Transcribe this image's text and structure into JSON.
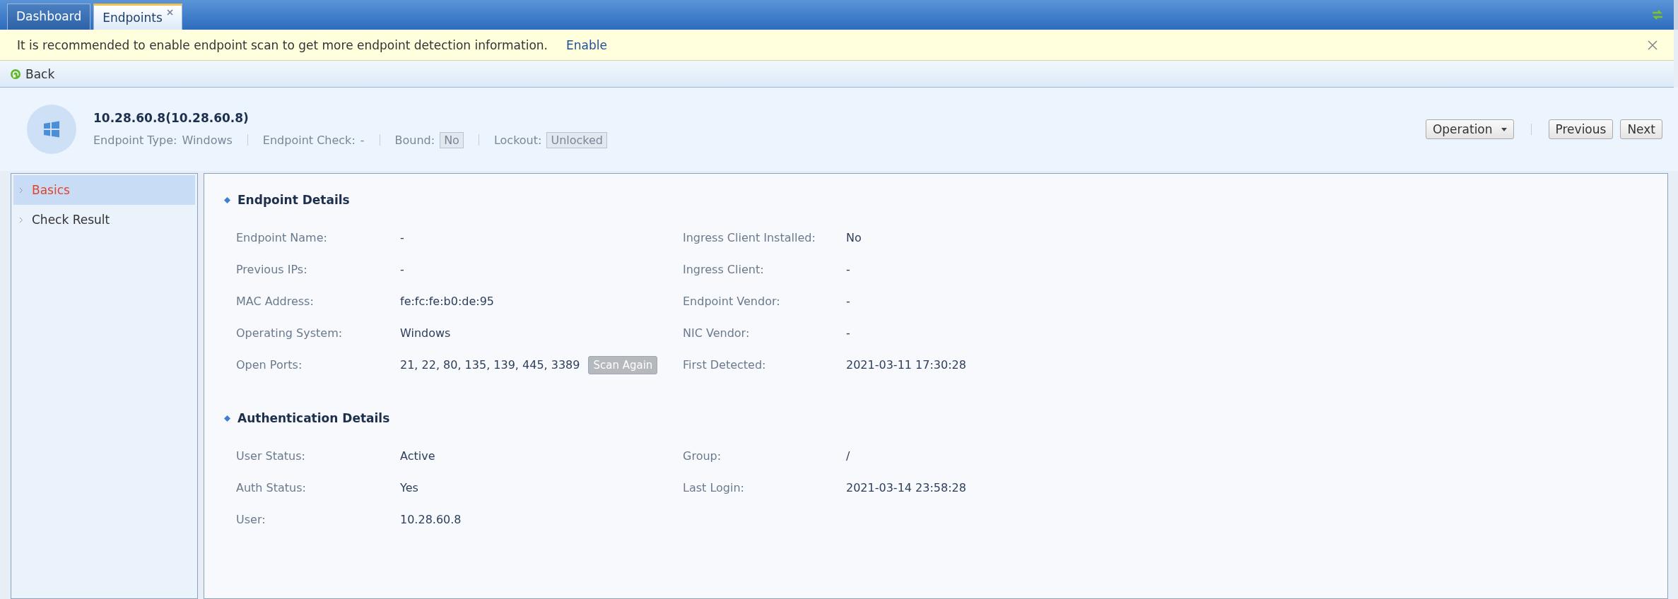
{
  "tabs": [
    {
      "label": "Dashboard",
      "selected": false,
      "closable": false
    },
    {
      "label": "Endpoints",
      "selected": true,
      "closable": true
    }
  ],
  "notice": {
    "text": "It is recommended to enable endpoint scan to get more endpoint detection information.",
    "link": "Enable"
  },
  "toolbar": {
    "back": "Back"
  },
  "endpoint": {
    "title": "10.28.60.8(10.28.60.8)",
    "meta": [
      {
        "label": "Endpoint Type:",
        "value": "Windows",
        "kind": "plain"
      },
      {
        "label": "Endpoint Check:",
        "value": "-",
        "kind": "plain"
      },
      {
        "label": "Bound:",
        "value": "No",
        "kind": "tag"
      },
      {
        "label": "Lockout:",
        "value": "Unlocked",
        "kind": "tag"
      }
    ],
    "actions": [
      {
        "label": "Operation",
        "kind": "dropdown"
      },
      {
        "label": "Previous",
        "kind": "button"
      },
      {
        "label": "Next",
        "kind": "button"
      }
    ]
  },
  "sidebar": {
    "items": [
      {
        "label": "Basics",
        "selected": true
      },
      {
        "label": "Check Result",
        "selected": false
      }
    ]
  },
  "sections": [
    {
      "title": "Endpoint Details",
      "rows": [
        {
          "left": {
            "label": "Endpoint Name:",
            "value": "-"
          },
          "right": {
            "label": "Ingress Client Installed:",
            "value": "No"
          }
        },
        {
          "left": {
            "label": "Previous IPs:",
            "value": "-"
          },
          "right": {
            "label": "Ingress Client:",
            "value": "-"
          }
        },
        {
          "left": {
            "label": "MAC Address:",
            "value": "fe:fc:fe:b0:de:95"
          },
          "right": {
            "label": "Endpoint Vendor:",
            "value": "-"
          }
        },
        {
          "left": {
            "label": "Operating System:",
            "value": "Windows"
          },
          "right": {
            "label": "NIC Vendor:",
            "value": "-"
          }
        },
        {
          "left": {
            "label": "Open Ports:",
            "value": "21, 22, 80, 135, 139, 445, 3389",
            "action": {
              "label": "Scan Again",
              "disabled": true
            }
          },
          "right": {
            "label": "First Detected:",
            "value": "2021-03-11 17:30:28"
          }
        }
      ]
    },
    {
      "title": "Authentication Details",
      "rows": [
        {
          "left": {
            "label": "User Status:",
            "value": "Active"
          },
          "right": {
            "label": "Group:",
            "value": "/"
          }
        },
        {
          "left": {
            "label": "Auth Status:",
            "value": "Yes"
          },
          "right": {
            "label": "Last Login:",
            "value": "2021-03-14 23:58:28"
          }
        },
        {
          "left": {
            "label": "User:",
            "value": "10.28.60.8"
          }
        }
      ]
    }
  ]
}
